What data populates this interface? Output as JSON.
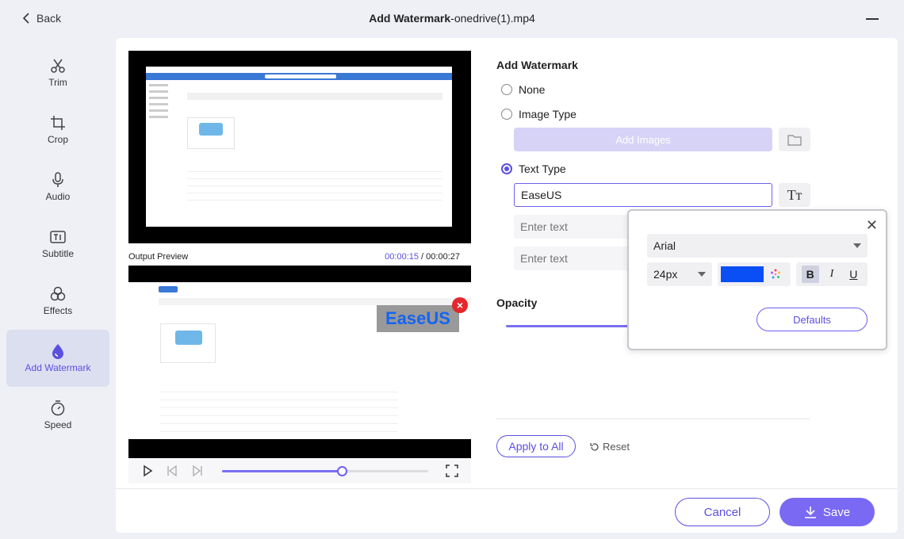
{
  "header": {
    "back_label": "Back",
    "title_bold": "Add Watermark",
    "title_file": "-onedrive(1).mp4"
  },
  "sidebar": {
    "items": [
      {
        "label": "Trim",
        "icon": "scissors-icon"
      },
      {
        "label": "Crop",
        "icon": "crop-icon"
      },
      {
        "label": "Audio",
        "icon": "microphone-icon"
      },
      {
        "label": "Subtitle",
        "icon": "subtitle-icon"
      },
      {
        "label": "Effects",
        "icon": "effects-icon"
      },
      {
        "label": "Add Watermark",
        "icon": "droplet-icon",
        "active": true
      },
      {
        "label": "Speed",
        "icon": "stopwatch-icon"
      }
    ]
  },
  "preview": {
    "output_label": "Output Preview",
    "current_time": "00:00:15",
    "separator": " / ",
    "total_time": "00:00:27",
    "watermark_text": "EaseUS",
    "progress": 0.58
  },
  "watermark": {
    "section_title": "Add Watermark",
    "options": {
      "none": "None",
      "image": "Image Type",
      "text": "Text Type"
    },
    "selected": "text",
    "add_images_label": "Add Images",
    "text_value": "EaseUS",
    "text_placeholder": "Enter text",
    "opacity_title": "Opacity",
    "apply_all_label": "Apply to All",
    "reset_label": "Reset"
  },
  "font_popup": {
    "font": "Arial",
    "size": "24px",
    "color": "#0a4ef5",
    "bold_label": "B",
    "italic_label": "I",
    "underline_label": "U",
    "defaults_label": "Defaults"
  },
  "footer": {
    "cancel_label": "Cancel",
    "save_label": "Save"
  },
  "colors": {
    "accent": "#5b4fe0",
    "save_bg": "#7a69f3",
    "close_red": "#e5262b"
  }
}
